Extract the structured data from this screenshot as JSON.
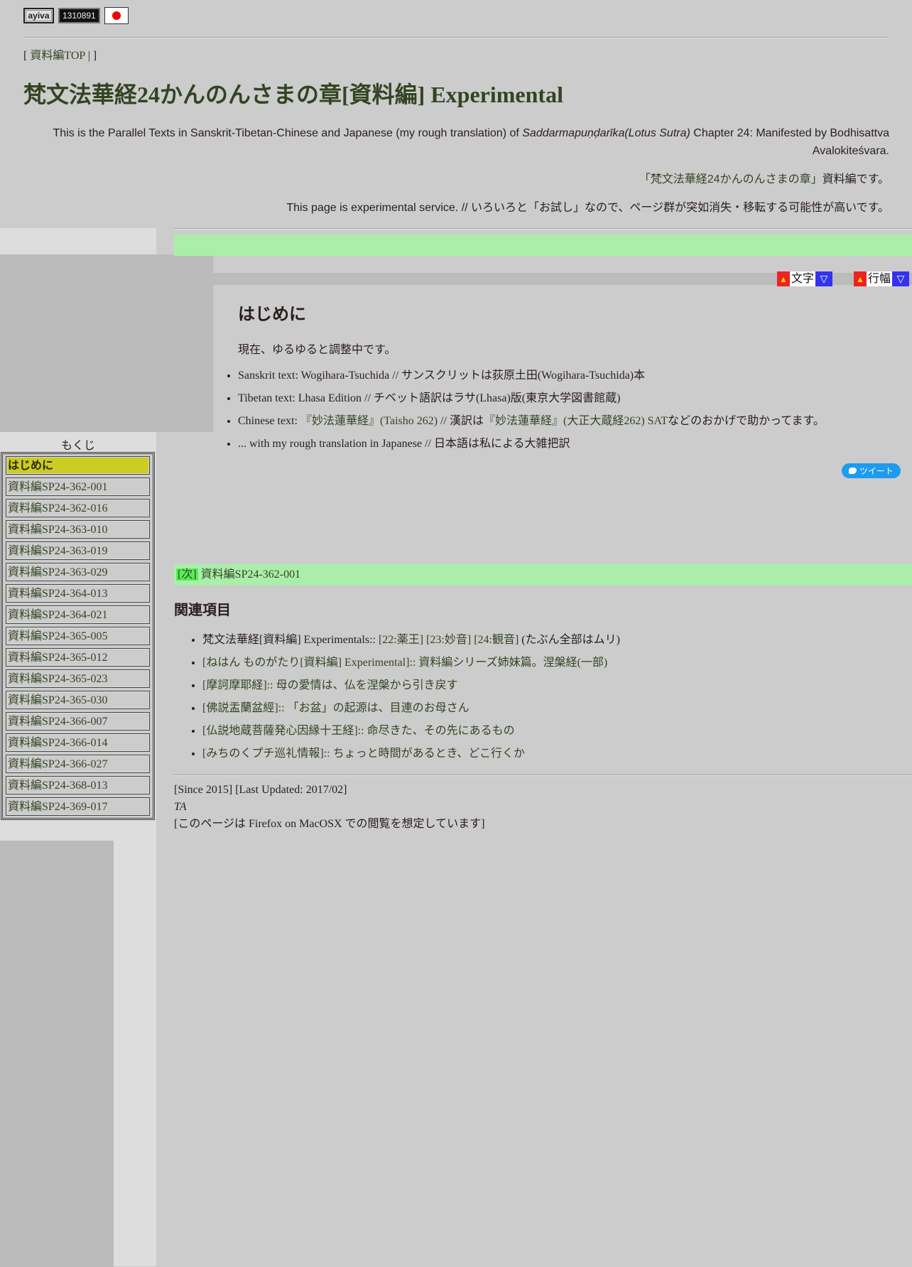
{
  "header": {
    "logo_label": "ayiva",
    "counter": "1310891",
    "breadcrumb_open": "[ ",
    "breadcrumb_link": "資料編TOP",
    "breadcrumb_close": " | ]",
    "title": "梵文法華経24かんのんさまの章[資料編] Experimental",
    "intro_before": "This is the Parallel Texts in Sanskrit-Tibetan-Chinese and Japanese (my rough translation) of ",
    "intro_italic": "Saddarmapuṇḍarīka(Lotus Sutra)",
    "intro_after": " Chapter 24: Manifested by Bodhisattva Avalokiteśvara.",
    "intro2_link": "「梵文法華経24かんのんさまの章」",
    "intro2_after": "資料編です。",
    "intro3": "This page is experimental service. // いろいろと「お試し」なので、ページ群が突如消失・移転する可能性が高いです。"
  },
  "sidebar": {
    "toc_label": "もくじ",
    "items": [
      {
        "label": "はじめに",
        "active": true
      },
      {
        "label": "資料編SP24-362-001"
      },
      {
        "label": "資料編SP24-362-016"
      },
      {
        "label": "資料編SP24-363-010"
      },
      {
        "label": "資料編SP24-363-019"
      },
      {
        "label": "資料編SP24-363-029"
      },
      {
        "label": "資料編SP24-364-013"
      },
      {
        "label": "資料編SP24-364-021"
      },
      {
        "label": "資料編SP24-365-005"
      },
      {
        "label": "資料編SP24-365-012"
      },
      {
        "label": "資料編SP24-365-023"
      },
      {
        "label": "資料編SP24-365-030"
      },
      {
        "label": "資料編SP24-366-007"
      },
      {
        "label": "資料編SP24-366-014"
      },
      {
        "label": "資料編SP24-366-027"
      },
      {
        "label": "資料編SP24-368-013"
      },
      {
        "label": "資料編SP24-369-017"
      }
    ]
  },
  "controls": {
    "up_glyph": "▲",
    "down_glyph": "▽",
    "font_label": "文字",
    "width_label": "行幅"
  },
  "main": {
    "section_title": "はじめに",
    "note": "現在、ゆるゆると調整中です。",
    "sources": {
      "s1": "Sanskrit text: Wogihara-Tsuchida // サンスクリットは荻原土田(Wogihara-Tsuchida)本",
      "s2": "Tibetan text: Lhasa Edition // チベット語訳はラサ(Lhasa)版(東京大学図書館蔵)",
      "s3_pre": "Chinese text: ",
      "s3_link1": "『妙法蓮華経』(Taisho 262)",
      "s3_mid": " // 漢訳は",
      "s3_link2": "『妙法蓮華経』(大正大蔵経262) SAT",
      "s3_post": "などのおかげで助かってます。",
      "s4": "... with my rough translation in Japanese // 日本語は私による大雑把訳"
    },
    "tweet_label": "ツイート",
    "next_tag": "[次]",
    "next_link": "資料編SP24-362-001"
  },
  "related": {
    "title": "関連項目",
    "r1_pre": "梵文法華経[資料編] Experimentals:: ",
    "r1_a": "[22:薬王]",
    "r1_b": "[23:妙音]",
    "r1_c": "[24:観音]",
    "r1_post": " (たぶん全部はムリ)",
    "r2_link": "[ねはん ものがたり[資料編] Experimental]",
    "r2_post": ":: 資料編シリーズ姉妹篇。涅槃経(一部)",
    "r3_link": "[摩訶摩耶経]",
    "r3_post": ":: 母の愛情は、仏を涅槃から引き戻す",
    "r4_link": "[佛説盂蘭盆經]",
    "r4_post": ":: 「お盆」の起源は、目連のお母さん",
    "r5_link": "[仏説地蔵菩薩発心因縁十王経]",
    "r5_post": ":: 命尽きた、その先にあるもの",
    "r6_link": "[みちのくプチ巡礼情報]",
    "r6_post": ":: ちょっと時間があるとき、どこ行くか"
  },
  "footer": {
    "line1": "[Since 2015] [Last Updated: 2017/02]",
    "author": "TA",
    "line3": "[このページは Firefox on MacOSX での閲覧を想定しています]"
  }
}
